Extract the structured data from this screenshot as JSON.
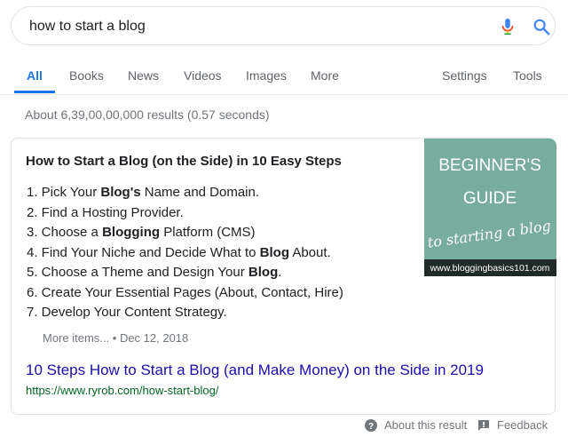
{
  "search": {
    "query": "how to start a blog"
  },
  "tabs": [
    {
      "label": "All"
    },
    {
      "label": "Books"
    },
    {
      "label": "News"
    },
    {
      "label": "Videos"
    },
    {
      "label": "Images"
    },
    {
      "label": "More"
    },
    {
      "label": "Settings"
    },
    {
      "label": "Tools"
    }
  ],
  "stats": "About 6,39,00,00,000 results (0.57 seconds)",
  "snippet": {
    "title": "How to Start a Blog (on the Side) in 10 Easy Steps",
    "steps": [
      {
        "pre": "1. Pick Your ",
        "bold": "Blog's",
        "post": " Name and Domain."
      },
      {
        "pre": "2. Find a Hosting Provider.",
        "bold": "",
        "post": ""
      },
      {
        "pre": "3. Choose a ",
        "bold": "Blogging",
        "post": " Platform (CMS)"
      },
      {
        "pre": "4. Find Your Niche and Decide What to ",
        "bold": "Blog",
        "post": " About."
      },
      {
        "pre": "5. Choose a Theme and Design Your ",
        "bold": "Blog",
        "post": "."
      },
      {
        "pre": "6. Create Your Essential Pages (About, Contact, Hire)",
        "bold": "",
        "post": ""
      },
      {
        "pre": "7. Develop Your Content Strategy.",
        "bold": "",
        "post": ""
      }
    ],
    "more_items": "More items...",
    "separator": "•",
    "date": "Dec 12, 2018",
    "image": {
      "line1": "BEGINNER'S",
      "line2": "GUIDE",
      "script": "to starting a blog",
      "site": "www.bloggingbasics101.com",
      "bg_color": "#7fb2a5"
    },
    "result_title": "10 Steps How to Start a Blog (and Make Money) on the Side in 2019",
    "result_url": "https://www.ryrob.com/how-start-blog/"
  },
  "footer": {
    "about": "About this result",
    "feedback": "Feedback"
  },
  "colors": {
    "accent": "#1a73e8",
    "link": "#1a0dab",
    "url": "#006621"
  }
}
